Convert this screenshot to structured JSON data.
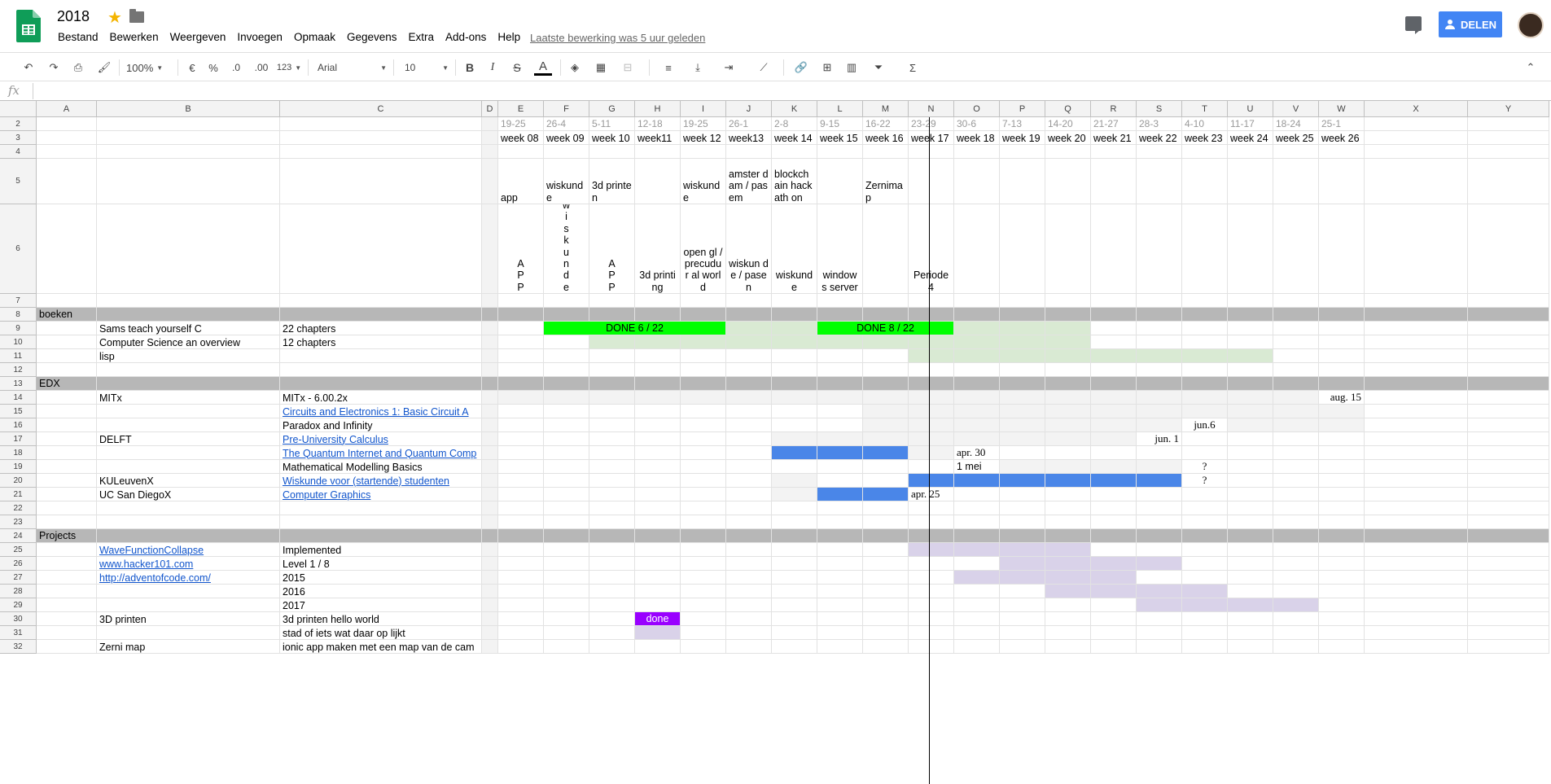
{
  "header": {
    "title": "2018",
    "menu": [
      "Bestand",
      "Bewerken",
      "Weergeven",
      "Invoegen",
      "Opmaak",
      "Gegevens",
      "Extra",
      "Add-ons",
      "Help"
    ],
    "last_edit": "Laatste bewerking was 5 uur geleden",
    "share_label": "DELEN",
    "icons": [
      "sheets-logo-icon",
      "star-icon",
      "folder-icon",
      "comment-icon",
      "share-person-icon",
      "avatar"
    ]
  },
  "toolbar": {
    "zoom": "100%",
    "currency": "€",
    "percent": "%",
    "dec_less": ".0",
    "dec_more": ".00",
    "format_more": "123",
    "font": "Arial",
    "font_size": "10",
    "bold": "B",
    "italic": "I",
    "strike": "S",
    "text_color": "A"
  },
  "formula_bar": {
    "fx": "fx",
    "value": ""
  },
  "colors": {
    "green": "#00ff00",
    "light_green": "#d9ead3",
    "blue": "#4a86e8",
    "purple": "#9900ff",
    "lavender": "#d9d2e9",
    "gray_band": "#b7b7b7",
    "light_gray": "#f3f3f3"
  },
  "columns": [
    "A",
    "B",
    "C",
    "D",
    "E",
    "F",
    "G",
    "H",
    "I",
    "J",
    "K",
    "L",
    "M",
    "N",
    "O",
    "P",
    "Q",
    "R",
    "S",
    "T",
    "U",
    "V",
    "W",
    "X",
    "Y"
  ],
  "rows": [
    "2",
    "3",
    "4",
    "5",
    "6",
    "7",
    "8",
    "9",
    "10",
    "11",
    "12",
    "13",
    "14",
    "15",
    "16",
    "17",
    "18",
    "19",
    "20",
    "21",
    "22",
    "23",
    "24",
    "25",
    "26",
    "27",
    "28",
    "29",
    "30",
    "31",
    "32"
  ],
  "cells": {
    "E2": "19-25",
    "F2": "26-4",
    "G2": "5-11",
    "H2": "12-18",
    "I2": "19-25",
    "J2": "26-1",
    "K2": "2-8",
    "L2": "9-15",
    "M2": "16-22",
    "N2": "23-29",
    "O2": "30-6",
    "P2": "7-13",
    "Q2": "14-20",
    "R2": "21-27",
    "S2": "28-3",
    "T2": "4-10",
    "U2": "11-17",
    "V2": "18-24",
    "W2": "25-1",
    "E3": "week 08",
    "F3": "week 09",
    "G3": "week 10",
    "H3": "week11",
    "I3": "week 12",
    "J3": "week13",
    "K3": "week 14",
    "L3": "week 15",
    "M3": "week 16",
    "N3": "week 17",
    "O3": "week 18",
    "P3": "week 19",
    "Q3": "week 20",
    "R3": "week 21",
    "S3": "week 22",
    "T3": "week 23",
    "U3": "week 24",
    "V3": "week 25",
    "W3": "week 26",
    "E5": "app",
    "F5": "wiskunde",
    "G5": "3d printen",
    "I5": "wiskunde",
    "J5": "amster dam / pasem",
    "K5": "blockch ain hackath on",
    "M5": "Zernima p",
    "E6": "A P P",
    "F6": "w i s k u n d e",
    "G6": "A P P",
    "H6": "3d printing",
    "I6": "open gl / precudur al world",
    "J6": "wiskun de / pasen",
    "K6": "wiskunde",
    "L6": "window s server",
    "N6": "Periode 4",
    "A8": "boeken",
    "B9": "Sams teach yourself C",
    "C9": "22 chapters",
    "F9": "DONE 6 / 22",
    "L9": "DONE 8 / 22",
    "B10": "Computer Science an overview",
    "C10": "12 chapters",
    "B11": "lisp",
    "A13": "EDX",
    "B14": "MITx",
    "C14": "MITx - 6.00.2x",
    "W14": "aug. 15",
    "C15": "Circuits and Electronics 1: Basic Circuit A",
    "C16": "Paradox and Infinity",
    "T16": "jun.6",
    "B17": "DELFT",
    "C17": "Pre-University Calculus",
    "S17": "jun. 1",
    "C18": "The Quantum Internet and Quantum Comp",
    "O18": "apr. 30",
    "C19": "Mathematical Modelling Basics",
    "O19": "1 mei",
    "T19": "?",
    "B20": "KULeuvenX",
    "C20": "Wiskunde voor (startende) studenten",
    "T20": "?",
    "B21": "UC San DiegoX",
    "C21": "Computer Graphics",
    "N21": "apr. 25",
    "A24": "Projects",
    "B25": "WaveFunctionCollapse",
    "C25": "Implemented",
    "B26": "www.hacker101.com",
    "C26": "Level 1 / 8",
    "B27": "http://adventofcode.com/",
    "C27": "2015",
    "C28": "2016",
    "C29": "2017",
    "B30": "3D printen",
    "C30": "3d printen hello world",
    "H30": "done",
    "C31": "stad of iets wat daar op lijkt",
    "B32": "Zerni map",
    "C32": "ionic app maken met een map van de cam"
  }
}
